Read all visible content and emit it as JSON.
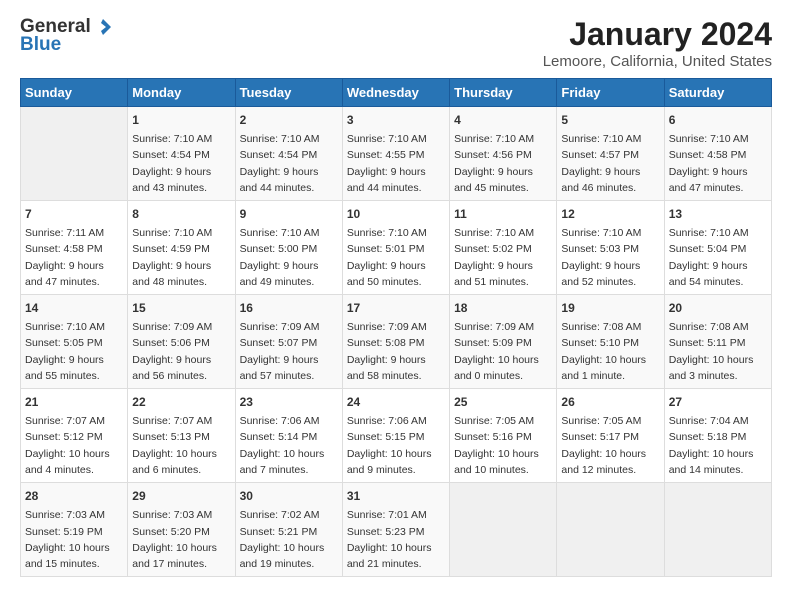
{
  "header": {
    "logo_general": "General",
    "logo_blue": "Blue",
    "title": "January 2024",
    "subtitle": "Lemoore, California, United States"
  },
  "calendar": {
    "days_of_week": [
      "Sunday",
      "Monday",
      "Tuesday",
      "Wednesday",
      "Thursday",
      "Friday",
      "Saturday"
    ],
    "weeks": [
      [
        {
          "day": "",
          "info": ""
        },
        {
          "day": "1",
          "info": "Sunrise: 7:10 AM\nSunset: 4:54 PM\nDaylight: 9 hours\nand 43 minutes."
        },
        {
          "day": "2",
          "info": "Sunrise: 7:10 AM\nSunset: 4:54 PM\nDaylight: 9 hours\nand 44 minutes."
        },
        {
          "day": "3",
          "info": "Sunrise: 7:10 AM\nSunset: 4:55 PM\nDaylight: 9 hours\nand 44 minutes."
        },
        {
          "day": "4",
          "info": "Sunrise: 7:10 AM\nSunset: 4:56 PM\nDaylight: 9 hours\nand 45 minutes."
        },
        {
          "day": "5",
          "info": "Sunrise: 7:10 AM\nSunset: 4:57 PM\nDaylight: 9 hours\nand 46 minutes."
        },
        {
          "day": "6",
          "info": "Sunrise: 7:10 AM\nSunset: 4:58 PM\nDaylight: 9 hours\nand 47 minutes."
        }
      ],
      [
        {
          "day": "7",
          "info": "Sunrise: 7:11 AM\nSunset: 4:58 PM\nDaylight: 9 hours\nand 47 minutes."
        },
        {
          "day": "8",
          "info": "Sunrise: 7:10 AM\nSunset: 4:59 PM\nDaylight: 9 hours\nand 48 minutes."
        },
        {
          "day": "9",
          "info": "Sunrise: 7:10 AM\nSunset: 5:00 PM\nDaylight: 9 hours\nand 49 minutes."
        },
        {
          "day": "10",
          "info": "Sunrise: 7:10 AM\nSunset: 5:01 PM\nDaylight: 9 hours\nand 50 minutes."
        },
        {
          "day": "11",
          "info": "Sunrise: 7:10 AM\nSunset: 5:02 PM\nDaylight: 9 hours\nand 51 minutes."
        },
        {
          "day": "12",
          "info": "Sunrise: 7:10 AM\nSunset: 5:03 PM\nDaylight: 9 hours\nand 52 minutes."
        },
        {
          "day": "13",
          "info": "Sunrise: 7:10 AM\nSunset: 5:04 PM\nDaylight: 9 hours\nand 54 minutes."
        }
      ],
      [
        {
          "day": "14",
          "info": "Sunrise: 7:10 AM\nSunset: 5:05 PM\nDaylight: 9 hours\nand 55 minutes."
        },
        {
          "day": "15",
          "info": "Sunrise: 7:09 AM\nSunset: 5:06 PM\nDaylight: 9 hours\nand 56 minutes."
        },
        {
          "day": "16",
          "info": "Sunrise: 7:09 AM\nSunset: 5:07 PM\nDaylight: 9 hours\nand 57 minutes."
        },
        {
          "day": "17",
          "info": "Sunrise: 7:09 AM\nSunset: 5:08 PM\nDaylight: 9 hours\nand 58 minutes."
        },
        {
          "day": "18",
          "info": "Sunrise: 7:09 AM\nSunset: 5:09 PM\nDaylight: 10 hours\nand 0 minutes."
        },
        {
          "day": "19",
          "info": "Sunrise: 7:08 AM\nSunset: 5:10 PM\nDaylight: 10 hours\nand 1 minute."
        },
        {
          "day": "20",
          "info": "Sunrise: 7:08 AM\nSunset: 5:11 PM\nDaylight: 10 hours\nand 3 minutes."
        }
      ],
      [
        {
          "day": "21",
          "info": "Sunrise: 7:07 AM\nSunset: 5:12 PM\nDaylight: 10 hours\nand 4 minutes."
        },
        {
          "day": "22",
          "info": "Sunrise: 7:07 AM\nSunset: 5:13 PM\nDaylight: 10 hours\nand 6 minutes."
        },
        {
          "day": "23",
          "info": "Sunrise: 7:06 AM\nSunset: 5:14 PM\nDaylight: 10 hours\nand 7 minutes."
        },
        {
          "day": "24",
          "info": "Sunrise: 7:06 AM\nSunset: 5:15 PM\nDaylight: 10 hours\nand 9 minutes."
        },
        {
          "day": "25",
          "info": "Sunrise: 7:05 AM\nSunset: 5:16 PM\nDaylight: 10 hours\nand 10 minutes."
        },
        {
          "day": "26",
          "info": "Sunrise: 7:05 AM\nSunset: 5:17 PM\nDaylight: 10 hours\nand 12 minutes."
        },
        {
          "day": "27",
          "info": "Sunrise: 7:04 AM\nSunset: 5:18 PM\nDaylight: 10 hours\nand 14 minutes."
        }
      ],
      [
        {
          "day": "28",
          "info": "Sunrise: 7:03 AM\nSunset: 5:19 PM\nDaylight: 10 hours\nand 15 minutes."
        },
        {
          "day": "29",
          "info": "Sunrise: 7:03 AM\nSunset: 5:20 PM\nDaylight: 10 hours\nand 17 minutes."
        },
        {
          "day": "30",
          "info": "Sunrise: 7:02 AM\nSunset: 5:21 PM\nDaylight: 10 hours\nand 19 minutes."
        },
        {
          "day": "31",
          "info": "Sunrise: 7:01 AM\nSunset: 5:23 PM\nDaylight: 10 hours\nand 21 minutes."
        },
        {
          "day": "",
          "info": ""
        },
        {
          "day": "",
          "info": ""
        },
        {
          "day": "",
          "info": ""
        }
      ]
    ]
  }
}
